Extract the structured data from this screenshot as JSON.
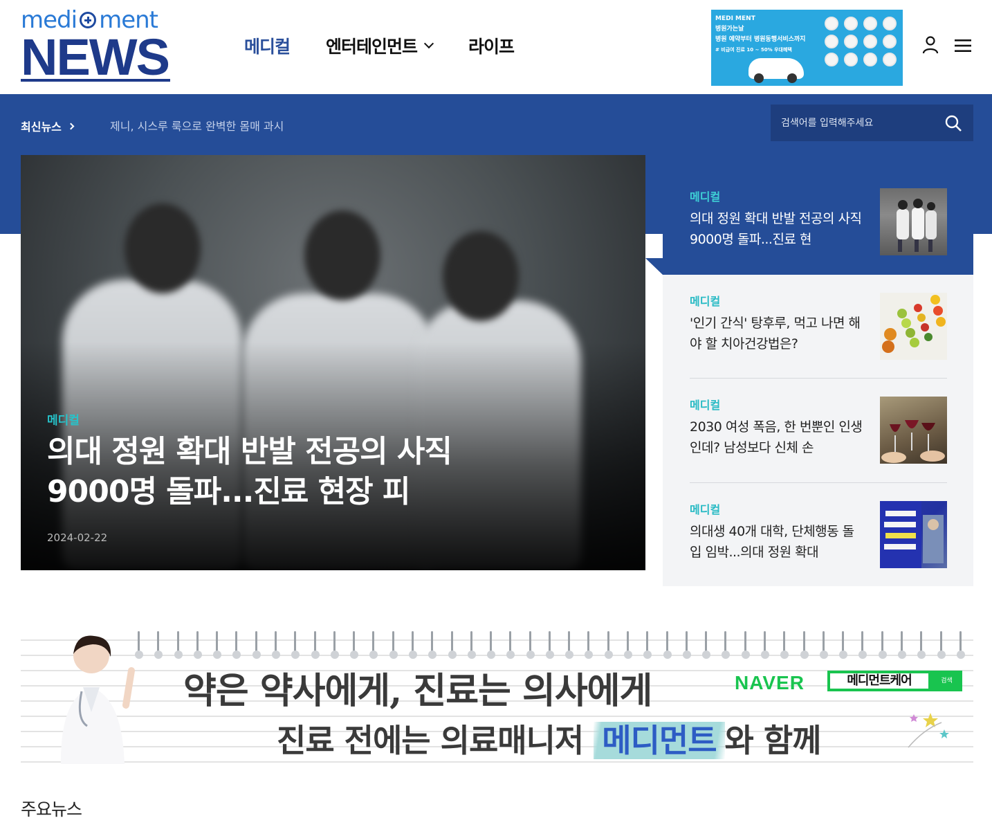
{
  "logo": {
    "top": "medi",
    "top2": "ment",
    "bottom": "NEWS"
  },
  "nav": {
    "items": [
      {
        "label": "메디컬",
        "active": true
      },
      {
        "label": "엔터테인먼트",
        "has_dropdown": true
      },
      {
        "label": "라이프"
      }
    ]
  },
  "header_ad": {
    "brand": "MEDI MENT",
    "line1": "병원가는날",
    "line2": "병원 예약부터 병원동행서비스까지",
    "line3": "# 비급여 진료 10 ~ 50% 우대혜택"
  },
  "latest_news": {
    "label": "최신뉴스",
    "ticker": "제니, 시스루 룩으로 완벽한 몸매 과시"
  },
  "search": {
    "placeholder": "검색어를 입력해주세요"
  },
  "hero": {
    "category": "메디컬",
    "title": "의대 정원 확대 반발 전공의 사직 9000명 돌파...진료 현장 피",
    "date": "2024-02-22"
  },
  "side_list": [
    {
      "category": "메디컬",
      "title": "의대 정원 확대 반발 전공의 사직 9000명 돌파...진료 현",
      "thumb": "doctors-walking",
      "active": true
    },
    {
      "category": "메디컬",
      "title": "'인기 간식' 탕후루, 먹고 나면 해야 할 치아건강법은?",
      "thumb": "tanghulu"
    },
    {
      "category": "메디컬",
      "title": "2030 여성 폭음, 한 번뿐인 인생인데? 남성보다 신체 손",
      "thumb": "wine-glasses"
    },
    {
      "category": "메디컬",
      "title": "의대생 40개 대학, 단체행동 돌입 임박...의대 정원 확대",
      "thumb": "protest-banner"
    }
  ],
  "banner": {
    "line1": "약은 약사에게, 진료는 의사에게",
    "line2_pre": "진료 전에는 의료매니저 ",
    "line2_hl": "메디먼트",
    "line2_post": "와 함께",
    "naver": "NAVER",
    "search_term": "메디먼트케어",
    "search_btn": "검색"
  },
  "sections": {
    "main_news": "주요뉴스"
  },
  "colors": {
    "brand_blue": "#254d98",
    "accent_teal": "#27c2c9",
    "naver_green": "#19c44f"
  }
}
